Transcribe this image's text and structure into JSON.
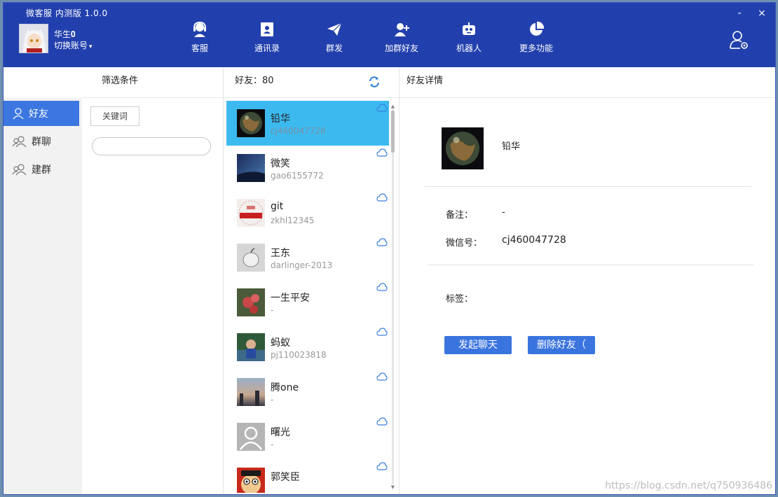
{
  "window": {
    "title": "微客服 内测版 1.0.0",
    "minimize": "-",
    "close": "×"
  },
  "account": {
    "name": "华生𝟎",
    "switch_label": "切换账号"
  },
  "nav": [
    {
      "label": "客服",
      "icon": "headset-icon"
    },
    {
      "label": "通讯录",
      "icon": "contacts-icon"
    },
    {
      "label": "群发",
      "icon": "send-icon"
    },
    {
      "label": "加群好友",
      "icon": "add-friend-icon"
    },
    {
      "label": "机器人",
      "icon": "robot-icon"
    },
    {
      "label": "更多功能",
      "icon": "pie-chart-icon"
    }
  ],
  "sidebar": {
    "items": [
      {
        "label": "好友",
        "active": true
      },
      {
        "label": "群聊",
        "active": false
      },
      {
        "label": "建群",
        "active": false
      }
    ]
  },
  "filter": {
    "title": "筛选条件",
    "keyword_button": "关键词",
    "input_value": ""
  },
  "friends": {
    "header": "好友：80",
    "items": [
      {
        "name": "铅华",
        "id": "cj460047728",
        "selected": true,
        "avatar_color": "#2c3a2a"
      },
      {
        "name": "微笑",
        "id": "gao6155772",
        "selected": false,
        "avatar_color": "#2b4f7a"
      },
      {
        "name": "git",
        "id": "zkhl12345",
        "selected": false,
        "avatar_color": "#d8d0cc"
      },
      {
        "name": "王东",
        "id": "darlinger-2013",
        "selected": false,
        "avatar_color": "#c8c8c8"
      },
      {
        "name": "一生平安",
        "id": "-",
        "selected": false,
        "avatar_color": "#5a3a2e"
      },
      {
        "name": "蚂蚁",
        "id": "pj110023818",
        "selected": false,
        "avatar_color": "#3e6a8a"
      },
      {
        "name": "腾one",
        "id": "-",
        "selected": false,
        "avatar_color": "#6a7a90"
      },
      {
        "name": "曙光",
        "id": "-",
        "selected": false,
        "avatar_color": "#b5b5b5"
      },
      {
        "name": "郭笑臣",
        "id": "",
        "selected": false,
        "avatar_color": "#c8281a"
      }
    ]
  },
  "detail": {
    "title": "好友详情",
    "name": "铅华",
    "remark_label": "备注：",
    "remark_value": "-",
    "wechat_label": "微信号：",
    "wechat_value": "cj460047728",
    "tags_label": "标签：",
    "start_chat": "发起聊天",
    "delete_friend": "删除好友（"
  },
  "watermark": "https://blog.csdn.net/q750936486",
  "colors": {
    "header": "#2240ad",
    "accent": "#3c76e0",
    "selected_row": "#3cbaf0"
  }
}
